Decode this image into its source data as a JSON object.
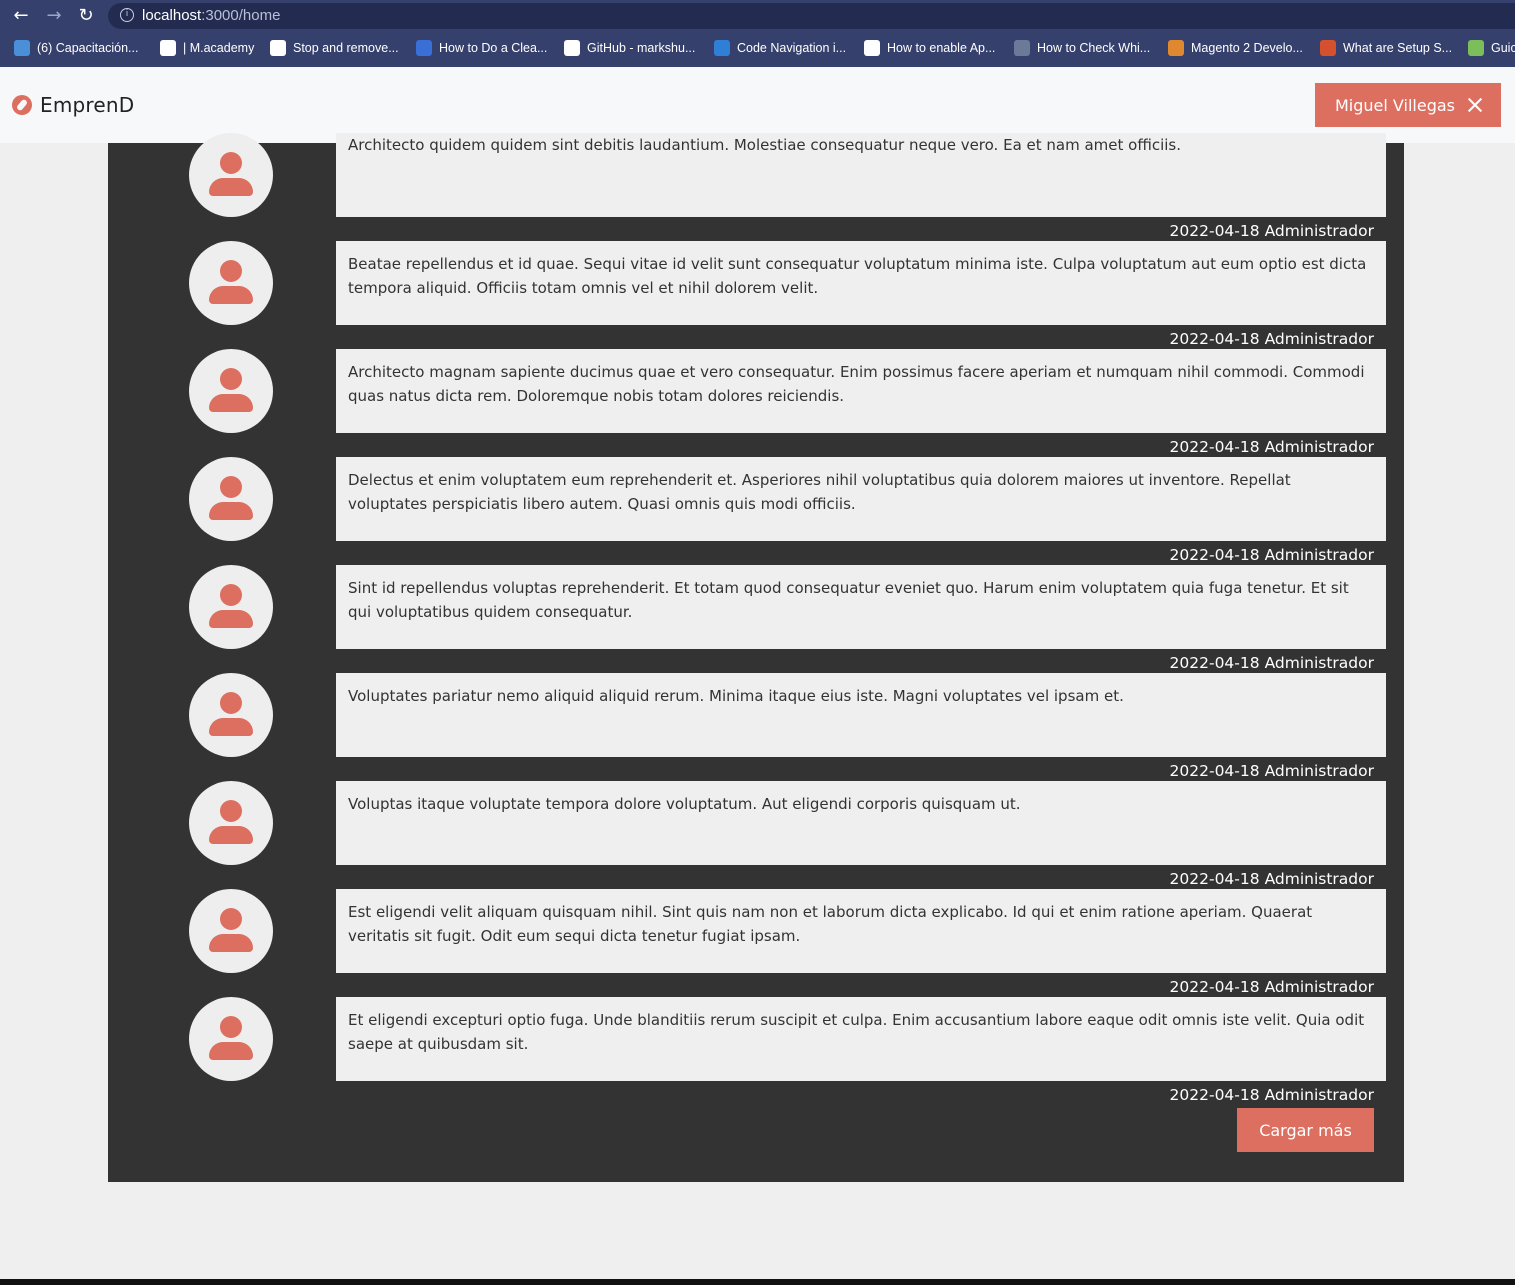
{
  "browser": {
    "url_host": "localhost",
    "url_path": ":3000/home",
    "bookmarks": [
      {
        "label": "(6) Capacitación...",
        "color": "#4a90d9"
      },
      {
        "label": "| M.academy",
        "color": "#ffffff"
      },
      {
        "label": "Stop and remove...",
        "color": "#ffffff"
      },
      {
        "label": "How to Do a Clea...",
        "color": "#3b6fd8"
      },
      {
        "label": "GitHub - markshu...",
        "color": "#ffffff"
      },
      {
        "label": "Code Navigation i...",
        "color": "#2f7fd6"
      },
      {
        "label": "How to enable Ap...",
        "color": "#ffffff"
      },
      {
        "label": "How to Check Whi...",
        "color": "#6c7a99"
      },
      {
        "label": "Magento 2 Develo...",
        "color": "#e0882f"
      },
      {
        "label": "What are Setup S...",
        "color": "#d4502f"
      },
      {
        "label": "Guic",
        "color": "#7cbf5a"
      }
    ]
  },
  "header": {
    "brand": "EmprenD",
    "user_name": "Miguel Villegas"
  },
  "posts": [
    {
      "text": "Architecto quidem quidem sint debitis laudantium. Molestiae consequatur neque vero. Ea et nam amet officiis.",
      "date": "2022-04-18",
      "author": "Administrador"
    },
    {
      "text": "Beatae repellendus et id quae. Sequi vitae id velit sunt consequatur voluptatum minima iste. Culpa voluptatum aut eum optio est dicta tempora aliquid. Officiis totam omnis vel et nihil dolorem velit.",
      "date": "2022-04-18",
      "author": "Administrador"
    },
    {
      "text": "Architecto magnam sapiente ducimus quae et vero consequatur. Enim possimus facere aperiam et numquam nihil commodi. Commodi quas natus dicta rem. Doloremque nobis totam dolores reiciendis.",
      "date": "2022-04-18",
      "author": "Administrador"
    },
    {
      "text": "Delectus et enim voluptatem eum reprehenderit et. Asperiores nihil voluptatibus quia dolorem maiores ut inventore. Repellat voluptates perspiciatis libero autem. Quasi omnis quis modi officiis.",
      "date": "2022-04-18",
      "author": "Administrador"
    },
    {
      "text": "Sint id repellendus voluptas reprehenderit. Et totam quod consequatur eveniet quo. Harum enim voluptatem quia fuga tenetur. Et sit qui voluptatibus quidem consequatur.",
      "date": "2022-04-18",
      "author": "Administrador"
    },
    {
      "text": "Voluptates pariatur nemo aliquid aliquid rerum. Minima itaque eius iste. Magni voluptates vel ipsam et.",
      "date": "2022-04-18",
      "author": "Administrador"
    },
    {
      "text": "Voluptas itaque voluptate tempora dolore voluptatum. Aut eligendi corporis quisquam ut.",
      "date": "2022-04-18",
      "author": "Administrador"
    },
    {
      "text": "Est eligendi velit aliquam quisquam nihil. Sint quis nam non et laborum dicta explicabo. Id qui et enim ratione aperiam. Quaerat veritatis sit fugit. Odit eum sequi dicta tenetur fugiat ipsam.",
      "date": "2022-04-18",
      "author": "Administrador"
    },
    {
      "text": "Et eligendi excepturi optio fuga. Unde blanditiis rerum suscipit et culpa. Enim accusantium labore eaque odit omnis iste velit. Quia odit saepe at quibusdam sit.",
      "date": "2022-04-18",
      "author": "Administrador"
    }
  ],
  "load_more_label": "Cargar más",
  "colors": {
    "accent": "#dd6f60",
    "panel": "#333333"
  }
}
